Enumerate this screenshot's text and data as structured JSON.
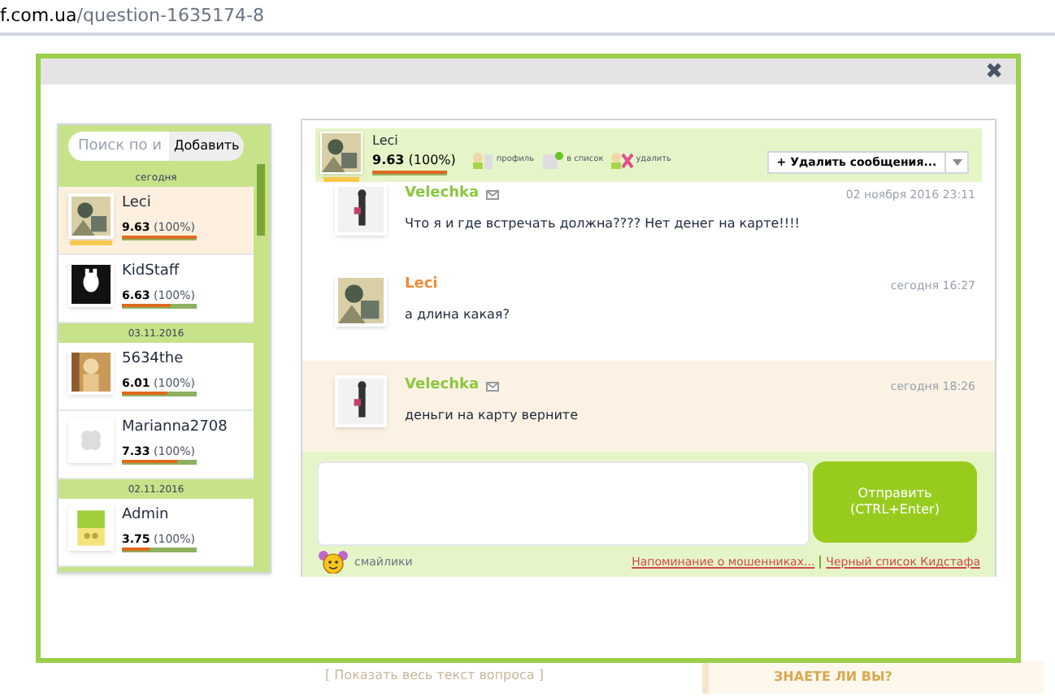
{
  "address_bar": {
    "domain": "f.com.ua",
    "path": "/question-1635174-8"
  },
  "background": {
    "link": "[ Показать весь текст вопроса ]",
    "widget_title": "ЗНАЕТЕ ЛИ ВЫ?"
  },
  "dialog": {
    "close": "✖"
  },
  "contacts": {
    "search": {
      "placeholder": "Поиск по и"
    },
    "add_button": "Добавить",
    "groups": [
      {
        "date": "сегодня",
        "items": [
          {
            "name": "Leci",
            "rating": "9.63",
            "percent": "(100%)",
            "level": 1.0,
            "selected": true
          },
          {
            "name": "KidStaff",
            "rating": "6.63",
            "percent": "(100%)",
            "level": 0.66,
            "selected": false
          }
        ]
      },
      {
        "date": "03.11.2016",
        "items": [
          {
            "name": "5634the",
            "rating": "6.01",
            "percent": "(100%)",
            "level": 0.6,
            "selected": false
          },
          {
            "name": "Marianna2708",
            "rating": "7.33",
            "percent": "(100%)",
            "level": 0.73,
            "selected": false
          }
        ]
      },
      {
        "date": "02.11.2016",
        "items": [
          {
            "name": "Admin",
            "rating": "3.75",
            "percent": "(100%)",
            "level": 0.38,
            "selected": false
          }
        ]
      }
    ]
  },
  "chat": {
    "header": {
      "name": "Leci",
      "rating": "9.63",
      "percent": "(100%)",
      "level": 1.0,
      "actions": [
        "профиль",
        "в список",
        "удалить"
      ],
      "menu": "+ Удалить сообщения..."
    },
    "messages": [
      {
        "author": "Velechka",
        "color": "#8cc63f",
        "mail": true,
        "time": "02 ноября 2016 23:11",
        "text": "Что я и где встречать должна???? Нет денег на карте!!!!",
        "highlighted": false
      },
      {
        "author": "Leci",
        "color": "#f08a3c",
        "mail": false,
        "time": "сегодня 16:27",
        "text": "а длина какая?",
        "highlighted": false
      },
      {
        "author": "Velechka",
        "color": "#8cc63f",
        "mail": true,
        "time": "сегодня 18:26",
        "text": "деньги на карту верните",
        "highlighted": true
      }
    ],
    "send_button": [
      "Отправить",
      "(CTRL+Enter)"
    ],
    "smileys": "смайлики",
    "links": [
      "Напоминание о мошенниках...",
      "Черный список Кидстафа"
    ]
  }
}
